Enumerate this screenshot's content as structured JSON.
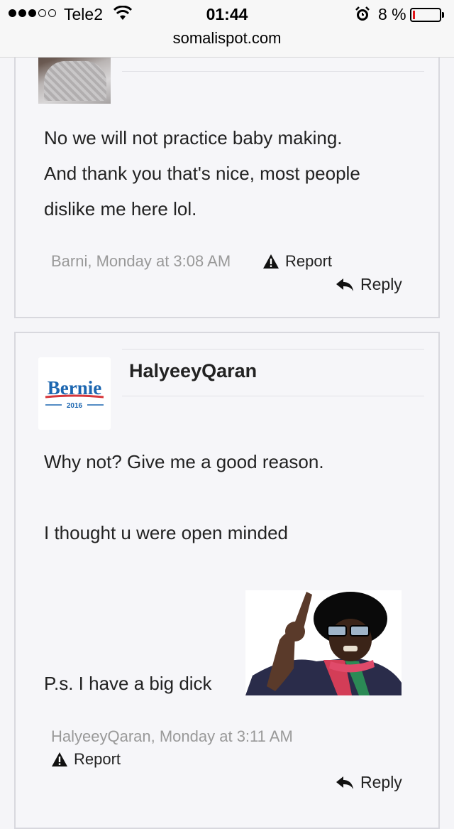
{
  "status_bar": {
    "carrier": "Tele2",
    "time": "01:44",
    "battery_percent": "8 %",
    "battery_level": 0.08,
    "signal_bars_filled": 3,
    "signal_bars_total": 5
  },
  "browser": {
    "url": "somalispot.com"
  },
  "posts": [
    {
      "author": "Barni",
      "lines": [
        "No we will not practice baby making.",
        "And thank you that's nice, most people",
        "dislike me here lol."
      ],
      "meta": "Barni, Monday at 3:08 AM",
      "report_label": "Report",
      "reply_label": "Reply"
    },
    {
      "author": "HalyeeyQaran",
      "avatar_text": "Bernie",
      "avatar_year": "2016",
      "lines": [
        "Why not? Give me a good reason.",
        "I thought u were open minded",
        "P.s. I have a big dick"
      ],
      "meta": "HalyeeyQaran, Monday at 3:11 AM",
      "report_label": "Report",
      "reply_label": "Reply"
    }
  ],
  "colors": {
    "page_bg": "#f5f5f8",
    "text": "#222222",
    "meta_text": "#999999",
    "bernie_blue": "#1c66b0",
    "bernie_red": "#d6363a",
    "battery_low": "#e0161a"
  }
}
